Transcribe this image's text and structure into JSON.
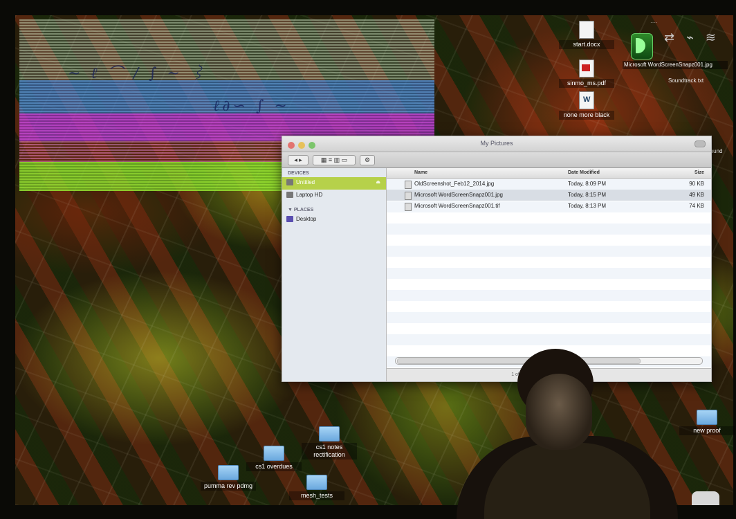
{
  "desktop": {
    "icons": [
      {
        "label": "start.docx",
        "kind": "doc"
      },
      {
        "label": "sinmo_ms.pdf",
        "kind": "pdf"
      },
      {
        "label": "none more black",
        "kind": "word"
      },
      {
        "label": "mesh_tests",
        "kind": "folder"
      },
      {
        "label": "pumma rev pdmg",
        "kind": "folder"
      },
      {
        "label": "cs1 overdues",
        "kind": "folder"
      },
      {
        "label": "cs1 notes rectification",
        "kind": "folder"
      },
      {
        "label": "new proof",
        "kind": "folder"
      }
    ],
    "selected_file_label": "Microsoft WordScreenSnapz001.jpg",
    "right_label": "Soundtrack.txt",
    "round_label": "round"
  },
  "finder": {
    "title": "My Pictures",
    "sidebar": {
      "devices_header": "DEVICES",
      "devices": [
        {
          "label": "Untitled",
          "selected": true
        },
        {
          "label": "Laptop HD",
          "selected": false
        }
      ],
      "places_header": "▼ PLACES",
      "places": [
        {
          "label": "Desktop"
        }
      ]
    },
    "columns": {
      "name": "Name",
      "date": "Date Modified",
      "size": "Size"
    },
    "files": [
      {
        "name": "OldScreenshot_Feb12_2014.jpg",
        "date": "Today, 8:09 PM",
        "size": "90 KB",
        "selected": false
      },
      {
        "name": "Microsoft WordScreenSnapz001.jpg",
        "date": "Today, 8:15 PM",
        "size": "49 KB",
        "selected": true
      },
      {
        "name": "Microsoft WordScreenSnapz001.tif",
        "date": "Today, 8:13 PM",
        "size": "74 KB",
        "selected": false
      }
    ],
    "status": "1 of 3 selected, 219.7 GB available"
  }
}
